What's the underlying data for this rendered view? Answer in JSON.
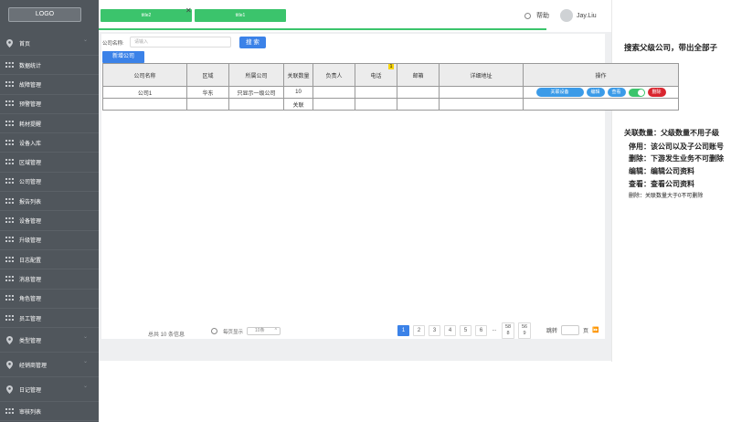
{
  "sidebar": {
    "logo": "LOGO",
    "items": [
      {
        "label": "首页",
        "icon": "location-pin-icon",
        "arrow": true
      },
      {
        "label": "数据统计",
        "icon": "grid-icon"
      },
      {
        "label": "故障管理",
        "icon": "grid-icon"
      },
      {
        "label": "预警管理",
        "icon": "grid-icon"
      },
      {
        "label": "耗材提醒",
        "icon": "grid-icon"
      },
      {
        "label": "设备入库",
        "icon": "grid-icon"
      },
      {
        "label": "区域管理",
        "icon": "grid-icon"
      },
      {
        "label": "公司管理",
        "icon": "grid-icon"
      },
      {
        "label": "报告列表",
        "icon": "grid-icon"
      },
      {
        "label": "设备管理",
        "icon": "grid-icon"
      },
      {
        "label": "升级管理",
        "icon": "grid-icon"
      },
      {
        "label": "日志配置",
        "icon": "grid-icon"
      },
      {
        "label": "消息管理",
        "icon": "grid-icon"
      },
      {
        "label": "角色管理",
        "icon": "grid-icon"
      },
      {
        "label": "员工管理",
        "icon": "grid-icon"
      },
      {
        "label": "类型管理",
        "icon": "location-pin-icon",
        "arrow": true
      },
      {
        "label": "经销商管理",
        "icon": "location-pin-icon",
        "arrow": true
      },
      {
        "label": "日记管理",
        "icon": "location-pin-icon",
        "arrow": true
      },
      {
        "label": "审核列表",
        "icon": "grid-icon"
      }
    ]
  },
  "tabs": [
    {
      "label": "title2",
      "active": true
    },
    {
      "label": "title1",
      "active": false
    }
  ],
  "header": {
    "help_label": "帮助",
    "user_name": "Jay.Liu"
  },
  "search": {
    "label": "公司名称:",
    "placeholder": "请输入",
    "button_label": "搜 索"
  },
  "add_button_label": "新增公司",
  "table": {
    "columns": [
      "公司名称",
      "区域",
      "所属公司",
      "关联数量",
      "负责人",
      "电话",
      "邮箱",
      "详细地址",
      "操作"
    ],
    "phone_badge": "1",
    "rows": [
      {
        "name": "公司1",
        "region": "华东",
        "parent": "只显示一级公司",
        "count": "10",
        "owner": "",
        "phone": "",
        "email": "",
        "address": ""
      },
      {
        "name": "",
        "region": "",
        "parent": "",
        "count": "关联",
        "owner": "",
        "phone": "",
        "email": "",
        "address": ""
      }
    ],
    "actions": {
      "related_devices": "关联设备",
      "edit": "编辑",
      "view": "查看",
      "delete": "删除"
    }
  },
  "pagination": {
    "total_text": "总共 10 条信息",
    "per_page_label": "每页显示",
    "per_page_value": "10条",
    "pages": [
      "1",
      "2",
      "3",
      "4",
      "5",
      "6",
      "..."
    ],
    "page_58": [
      "58",
      "8"
    ],
    "page_59": [
      "56",
      "9"
    ],
    "jump_label": "跳转",
    "page_suffix": "页",
    "go_label": "⏩",
    "current_page": "1"
  },
  "notes": {
    "search_note": "搜索父级公司，带出全部子",
    "count_note": "关联数量：父级数量不用子级",
    "disable_note": "停用：该公司以及子公司账号",
    "delete_note": "删除：下游发生业务不可删除",
    "edit_note": "编辑：编辑公司资料",
    "view_note": "查看：查看公司资料",
    "delete_note2": "删除：关联数量大于0不可删除"
  },
  "colors": {
    "sidebar_bg": "#50565c",
    "accent_green": "#3bc46c",
    "accent_blue": "#3b82e8",
    "delete_red": "#d9262f"
  }
}
